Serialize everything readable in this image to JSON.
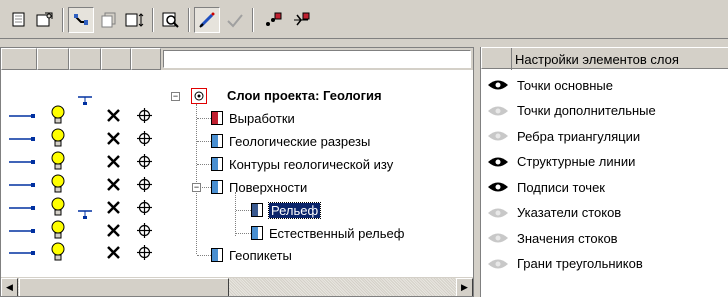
{
  "toolbar": {
    "buttons": [
      {
        "icon": "layer-sheet-icon"
      },
      {
        "icon": "layer-properties-icon"
      },
      {
        "icon": "link-tool-icon",
        "pressed": true
      },
      {
        "icon": "copy-layer-icon"
      },
      {
        "icon": "resize-layer-icon"
      },
      {
        "icon": "preview-zoom-icon"
      },
      {
        "icon": "edit-pencil-icon",
        "pressed": true
      },
      {
        "icon": "apply-check-icon"
      },
      {
        "icon": "point-tool-icon"
      },
      {
        "icon": "structure-tool-icon"
      }
    ]
  },
  "tree": {
    "root_label": "Слои проекта: Геология",
    "items": [
      {
        "label": "Выработки",
        "level": 1,
        "color": "#c02030"
      },
      {
        "label": "Геологические разрезы",
        "level": 1,
        "color": "#4a8fd0"
      },
      {
        "label": "Контуры геологической изу",
        "level": 1,
        "color": "#4a8fd0"
      },
      {
        "label": "Поверхности",
        "level": 1,
        "color": "#4a8fd0",
        "expanded": true
      },
      {
        "label": "Рельеф",
        "level": 2,
        "color": "#3a5a90",
        "selected": true
      },
      {
        "label": "Естественный рельеф",
        "level": 2,
        "color": "#4a8fd0"
      },
      {
        "label": "Геопикеты",
        "level": 1,
        "color": "#4a8fd0"
      }
    ]
  },
  "settings": {
    "header": "Настройки элементов слоя",
    "items": [
      {
        "label": "Точки основные",
        "visible": true
      },
      {
        "label": "Точки дополнительные",
        "visible": false
      },
      {
        "label": "Ребра триангуляции",
        "visible": false
      },
      {
        "label": "Структурные линии",
        "visible": true
      },
      {
        "label": "Подписи точек",
        "visible": true
      },
      {
        "label": "Указатели стоков",
        "visible": false
      },
      {
        "label": "Значения стоков",
        "visible": false
      },
      {
        "label": "Грани треугольников",
        "visible": false
      }
    ]
  }
}
